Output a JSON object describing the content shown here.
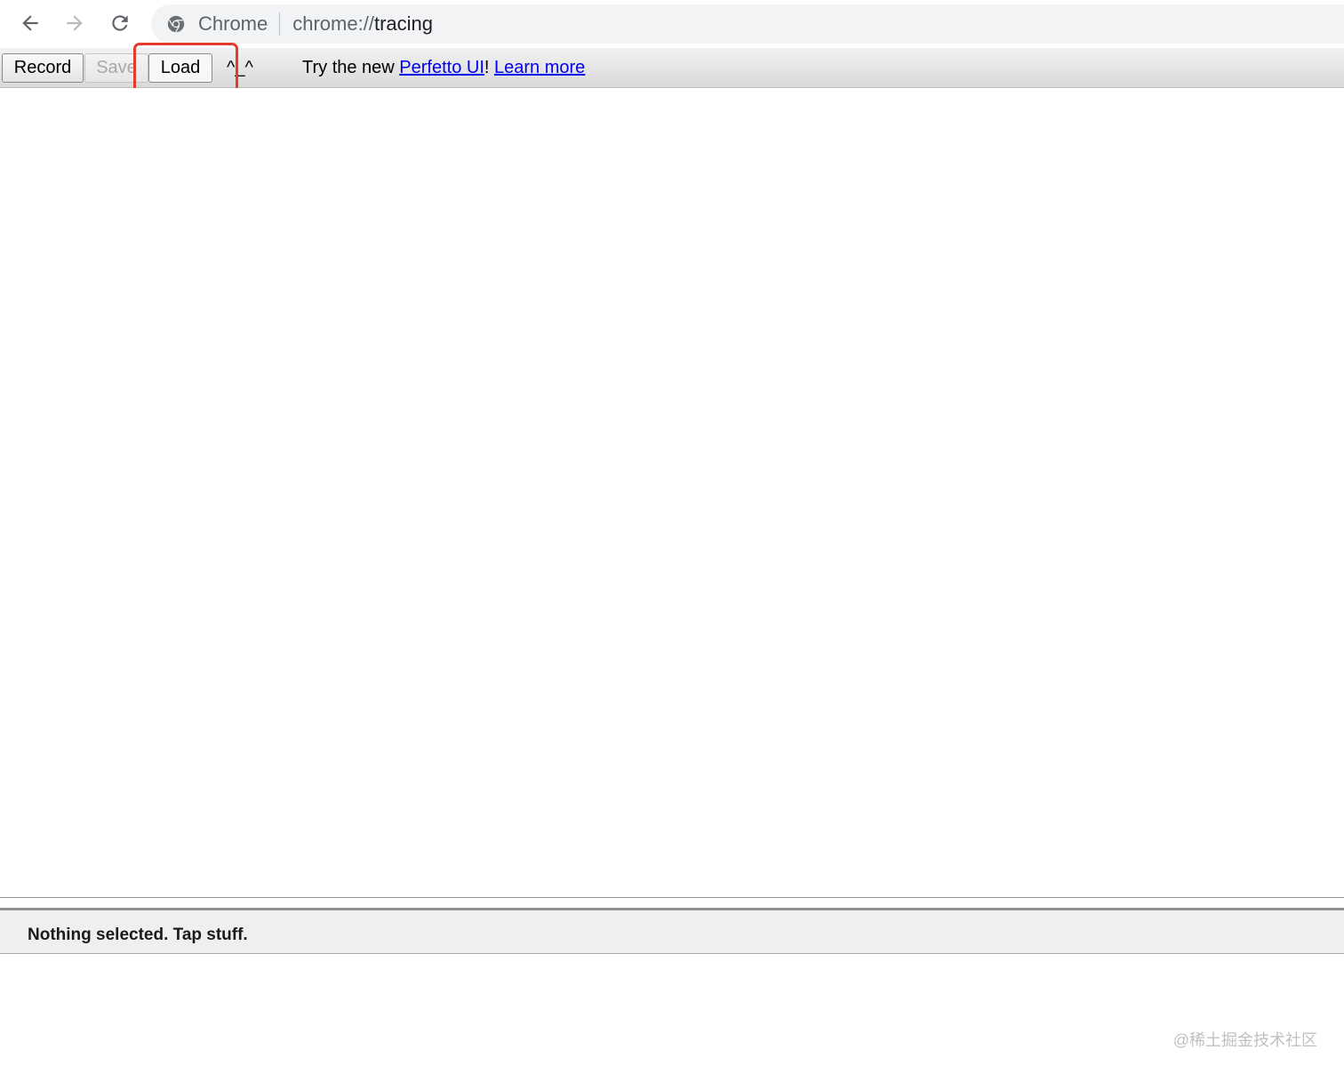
{
  "browser": {
    "site_name": "Chrome",
    "url_scheme": "chrome://",
    "url_path": "tracing",
    "icons": {
      "back": "arrow-left-icon",
      "forward": "arrow-right-icon",
      "reload": "reload-icon",
      "site": "chrome-logo-icon"
    }
  },
  "toolbar": {
    "record_label": "Record",
    "save_label": "Save",
    "load_label": "Load",
    "carets": "^_^",
    "promo_prefix": "Try the new ",
    "perfetto_link": "Perfetto UI",
    "promo_bang": "!",
    "learn_more_link": "Learn more"
  },
  "analysis": {
    "status_text": "Nothing selected. Tap stuff."
  },
  "watermark": "@稀土掘金技术社区",
  "colors": {
    "highlight": "#e63a2e",
    "link": "#1a0dab",
    "toolbar_bg": "#e4e4e4"
  }
}
